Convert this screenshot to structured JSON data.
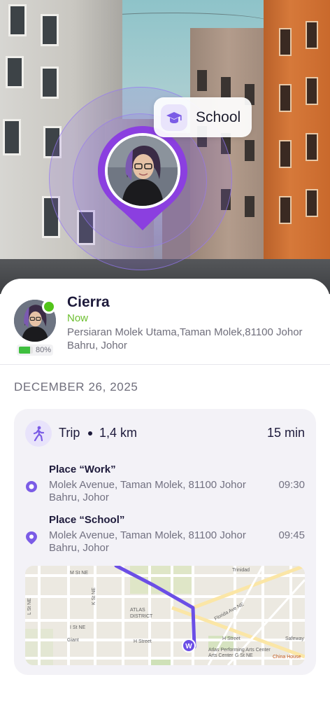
{
  "hero": {
    "place_tag": {
      "label": "School",
      "icon": "graduation-cap-icon"
    },
    "pin_color": "#8b3fe0"
  },
  "user": {
    "name": "Cierra",
    "status": "Now",
    "address": "Persiaran Molek Utama,Taman Molek,81100 Johor Bahru, Johor",
    "battery_level": 0.8,
    "battery_text": "80%",
    "online": true
  },
  "date_header": "DECEMBER 26, 2025",
  "trip": {
    "mode_icon": "walking-icon",
    "label": "Trip",
    "distance": "1,4 km",
    "duration": "15 min",
    "places": [
      {
        "name": "Place “Work”",
        "address": "Molek Avenue, Taman Molek, 81100 Johor Bahru, Johor",
        "time": "09:30",
        "icon": "target-dot-icon"
      },
      {
        "name": "Place “School”",
        "address": "Molek Avenue, Taman Molek, 81100 Johor Bahru, Johor",
        "time": "09:45",
        "icon": "map-pin-icon"
      }
    ],
    "map": {
      "street_labels": [
        "M St NE",
        "L St NE",
        "K St NE",
        "I St NE",
        "H Street",
        "G St NE",
        "Florida Ave NE",
        "Trinidad",
        "Atlas District",
        "Giant",
        "Safeway",
        "Atlas Performing Arts Center",
        "China House",
        "W"
      ],
      "route_color": "#6b4ee6",
      "marker_letter": "W"
    }
  },
  "colors": {
    "accent": "#7b5ce6",
    "online": "#52c41a",
    "status_now": "#6cbf2e"
  }
}
